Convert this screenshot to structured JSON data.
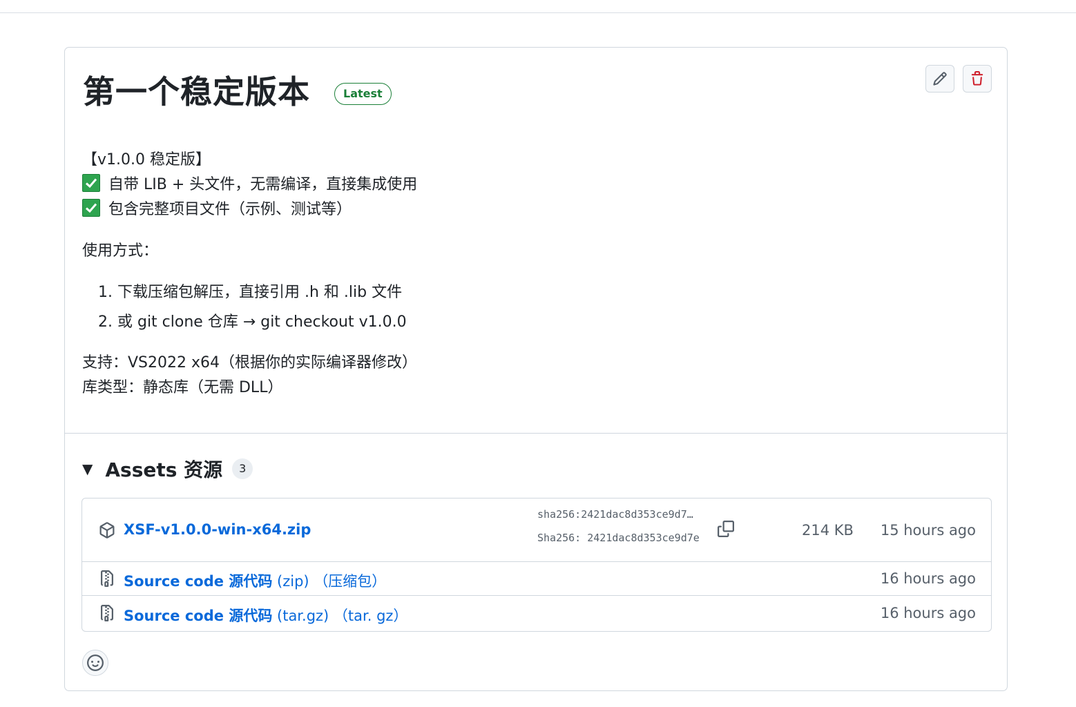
{
  "release": {
    "title": "第一个稳定版本",
    "badge": "Latest",
    "actions": {
      "edit_icon": "pencil-icon",
      "delete_icon": "trash-icon"
    }
  },
  "notes": {
    "version_line": "【v1.0.0 稳定版】",
    "features": [
      "自带 LIB + 头文件，无需编译，直接集成使用",
      "包含完整项目文件（示例、测试等）"
    ],
    "usage_heading": "使用方式：",
    "steps": [
      "1. 下载压缩包解压，直接引用 .h 和 .lib 文件",
      "2. 或 git clone 仓库 → git checkout v1.0.0"
    ],
    "support": "支持：VS2022 x64（根据你的实际编译器修改）",
    "lib_type": "库类型：静态库（无需 DLL）"
  },
  "assets": {
    "title": "Assets 资源",
    "count": "3",
    "items": [
      {
        "name": "XSF-v1.0.0-win-x64.zip",
        "sha_1": "sha256:2421dac8d353ce9d7…",
        "sha_2": "Sha256: 2421dac8d353ce9d7e",
        "size": "214 KB",
        "time": "15 hours ago"
      },
      {
        "name_bold": "Source code 源代码",
        "ext": "(zip) （压缩包）",
        "time": "16 hours ago"
      },
      {
        "name_bold": "Source code 源代码",
        "ext": "(tar.gz) （tar. gz）",
        "time": "16 hours ago"
      }
    ]
  },
  "colors": {
    "accent": "#0969da",
    "success": "#1a7f37",
    "danger": "#cf222e",
    "muted": "#57606a"
  }
}
